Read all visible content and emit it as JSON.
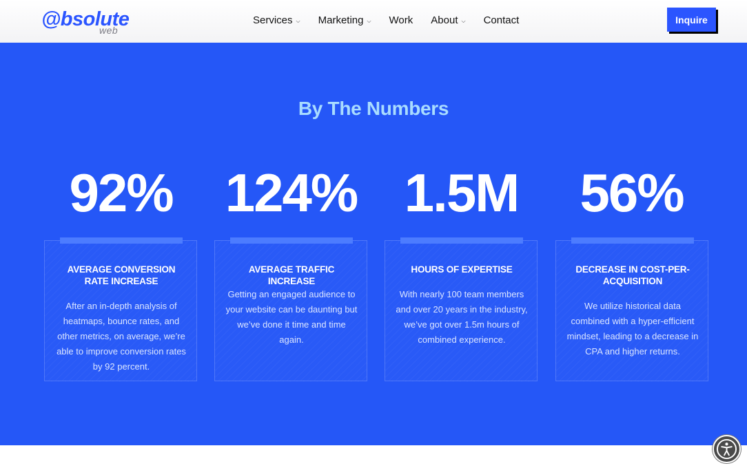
{
  "header": {
    "logo_main": "@bsolute",
    "logo_sub": "web",
    "nav": [
      {
        "label": "Services",
        "dropdown": true
      },
      {
        "label": "Marketing",
        "dropdown": true
      },
      {
        "label": "Work",
        "dropdown": false
      },
      {
        "label": "About",
        "dropdown": true
      },
      {
        "label": "Contact",
        "dropdown": false
      }
    ],
    "cta_label": "Inquire"
  },
  "numbers": {
    "title": "By The Numbers",
    "stats": [
      {
        "value": "92%",
        "title": "AVERAGE CONVERSION RATE INCREASE",
        "text": "After an in-depth analysis of heatmaps, bounce rates, and other metrics, on average, we’re able to improve conversion rates by 92 percent."
      },
      {
        "value": "124%",
        "title": "AVERAGE TRAFFIC INCREASE",
        "text": "Getting an engaged audience to your website can be daunting but we’ve done it time and time again."
      },
      {
        "value": "1.5M",
        "title": "HOURS OF EXPERTISE",
        "text": "With nearly 100 team members and over 20 years in the industry, we’ve got over 1.5m hours of combined experience."
      },
      {
        "value": "56%",
        "title": "DECREASE IN COST-PER-ACQUISITION",
        "text": "We utilize historical data combined with a hyper-efficient mindset, leading to a decrease in CPA and higher returns."
      }
    ]
  },
  "colors": {
    "brand_blue": "#2557f7",
    "title_light_blue": "#a9dcff",
    "card_bar": "#4c7cff"
  },
  "icons": {
    "dropdown": "chevron-down-icon",
    "accessibility": "accessibility-icon"
  }
}
